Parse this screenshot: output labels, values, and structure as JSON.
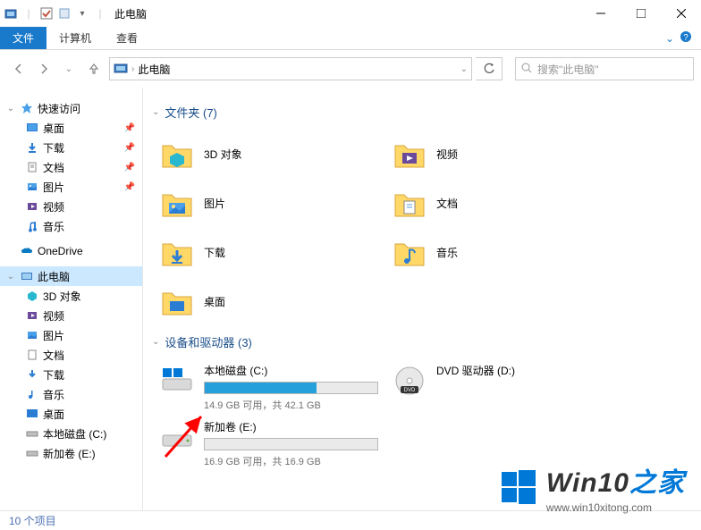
{
  "titlebar": {
    "title": "此电脑"
  },
  "ribbon": {
    "file": "文件",
    "computer": "计算机",
    "view": "查看"
  },
  "breadcrumb": {
    "location": "此电脑"
  },
  "search": {
    "placeholder": "搜索\"此电脑\""
  },
  "sidebar": {
    "quickaccess": "快速访问",
    "qa": {
      "desktop": "桌面",
      "downloads": "下载",
      "documents": "文档",
      "pictures": "图片",
      "videos": "视频",
      "music": "音乐"
    },
    "onedrive": "OneDrive",
    "thispc": "此电脑",
    "pc": {
      "objects3d": "3D 对象",
      "videos": "视频",
      "pictures": "图片",
      "documents": "文档",
      "downloads": "下载",
      "music": "音乐",
      "desktop": "桌面",
      "driveC": "本地磁盘 (C:)",
      "driveE": "新加卷 (E:)"
    }
  },
  "main": {
    "folders_header": "文件夹 (7)",
    "drives_header": "设备和驱动器 (3)",
    "folders": {
      "objects3d": "3D 对象",
      "videos": "视频",
      "pictures": "图片",
      "documents": "文档",
      "downloads": "下载",
      "music": "音乐",
      "desktop": "桌面"
    },
    "driveC": {
      "name": "本地磁盘 (C:)",
      "stats": "14.9 GB 可用，共 42.1 GB",
      "fill_pct": 65
    },
    "driveE": {
      "name": "新加卷 (E:)",
      "stats": "16.9 GB 可用，共 16.9 GB",
      "fill_pct": 0
    },
    "dvd": {
      "name": "DVD 驱动器 (D:)"
    }
  },
  "statusbar": {
    "text": "10 个项目"
  },
  "watermark": {
    "title": "Win10",
    "suffix": "之家",
    "url": "www.win10xitong.com"
  }
}
